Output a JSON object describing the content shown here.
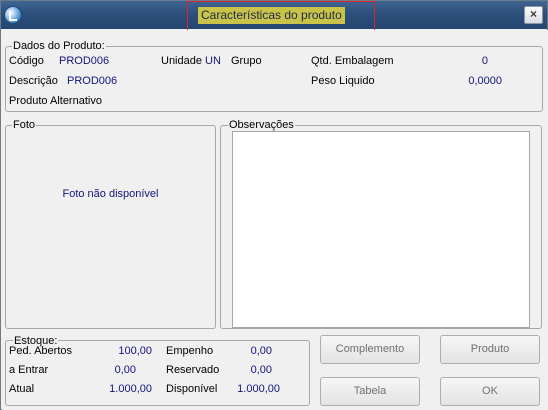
{
  "window": {
    "title": "Características do produto",
    "close_label": "×"
  },
  "dados": {
    "legend": "Dados do Produto:",
    "codigo_label": "Código",
    "codigo_value": "PROD006",
    "unidade_label": "Unidade",
    "unidade_value": "UN",
    "grupo_label": "Grupo",
    "qtd_embalagem_label": "Qtd. Embalagem",
    "qtd_embalagem_value": "0",
    "descricao_label": "Descrição",
    "descricao_value": "PROD006",
    "peso_liquido_label": "Peso Liquido",
    "peso_liquido_value": "0,0000",
    "produto_alternativo_label": "Produto Alternativo"
  },
  "foto": {
    "legend": "Foto",
    "message": "Foto não disponível"
  },
  "observacoes": {
    "legend": "Observações"
  },
  "estoque": {
    "legend": "Estoque:",
    "ped_abertos_label": "Ped. Abertos",
    "ped_abertos_value": "100,00",
    "empenho_label": "Empenho",
    "empenho_value": "0,00",
    "a_entrar_label": "a Entrar",
    "a_entrar_value": "0,00",
    "reservado_label": "Reservado",
    "reservado_value": "0,00",
    "atual_label": "Atual",
    "atual_value": "1.000,00",
    "disponivel_label": "Disponível",
    "disponivel_value": "1.000,00"
  },
  "buttons": {
    "complemento": "Complemento",
    "produto": "Produto",
    "tabela": "Tabela",
    "ok": "OK"
  },
  "colors": {
    "titlebar": "#2d4f7a",
    "title_highlight": "#c9c34a",
    "annotation_box": "#d9262b",
    "value_text": "#15147b"
  }
}
